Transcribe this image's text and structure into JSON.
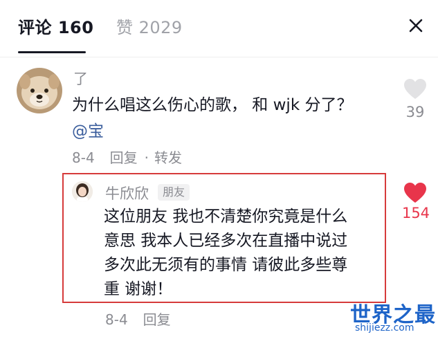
{
  "header": {
    "tab_comments": "评论 160",
    "tab_likes": "赞 2029"
  },
  "comment": {
    "username": "了",
    "text": "为什么唱这么伤心的歌， 和 wjk 分了？",
    "mention": "@宝",
    "date": "8-4",
    "reply_action": "回复",
    "separator": "·",
    "share_action": "转发",
    "like_count": "39",
    "liked": false
  },
  "reply": {
    "username": "牛欣欣",
    "badge": "朋友",
    "lines": [
      "这位朋友 我也不清楚你究竟是什么",
      "意思 我本人已经多次在直播中说过",
      "多次此无须有的事情 请彼此多些尊",
      "重 谢谢！"
    ],
    "date": "8-4",
    "reply_action": "回复",
    "like_count": "154",
    "liked": true,
    "like_color": "#e8354b"
  },
  "watermark": {
    "text": "世界之最",
    "url": "shijiezz.com"
  }
}
